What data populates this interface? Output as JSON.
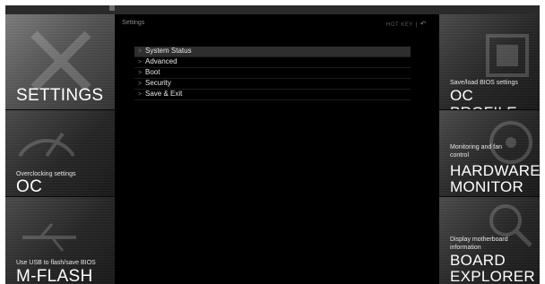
{
  "left_tiles": [
    {
      "id": "settings",
      "caption": "",
      "title": "SETTINGS",
      "active": true
    },
    {
      "id": "oc",
      "caption": "Overclocking settings",
      "title": "OC",
      "active": false
    },
    {
      "id": "mflash",
      "caption": "Use USB to flash/save BIOS",
      "title": "M-FLASH",
      "active": false
    }
  ],
  "right_tiles": [
    {
      "id": "oc-profile",
      "caption": "Save/load BIOS settings",
      "title": "OC PROFILE"
    },
    {
      "id": "hardware-monitor",
      "caption": "Monitoring and fan control",
      "title_line1": "HARDWARE",
      "title_line2": "MONITOR"
    },
    {
      "id": "board-explorer",
      "caption": "Display motherboard information",
      "title_line1": "BOARD",
      "title_line2": "EXPLORER"
    }
  ],
  "main": {
    "breadcrumb": "Settings",
    "hotkey_label": "HOT KEY",
    "hotkey_separator": "|",
    "back_symbol": "↶",
    "menu_items": [
      {
        "label": "System Status",
        "selected": true
      },
      {
        "label": "Advanced",
        "selected": false
      },
      {
        "label": "Boot",
        "selected": false
      },
      {
        "label": "Security",
        "selected": false
      },
      {
        "label": "Save & Exit",
        "selected": false
      }
    ],
    "chevron": ">"
  },
  "colors": {
    "background": "#050505",
    "tile_active": "#5a5a5a",
    "tile": "#2f2f2f",
    "text": "#f2f2f2",
    "selected_row": "#2e2e2e"
  }
}
